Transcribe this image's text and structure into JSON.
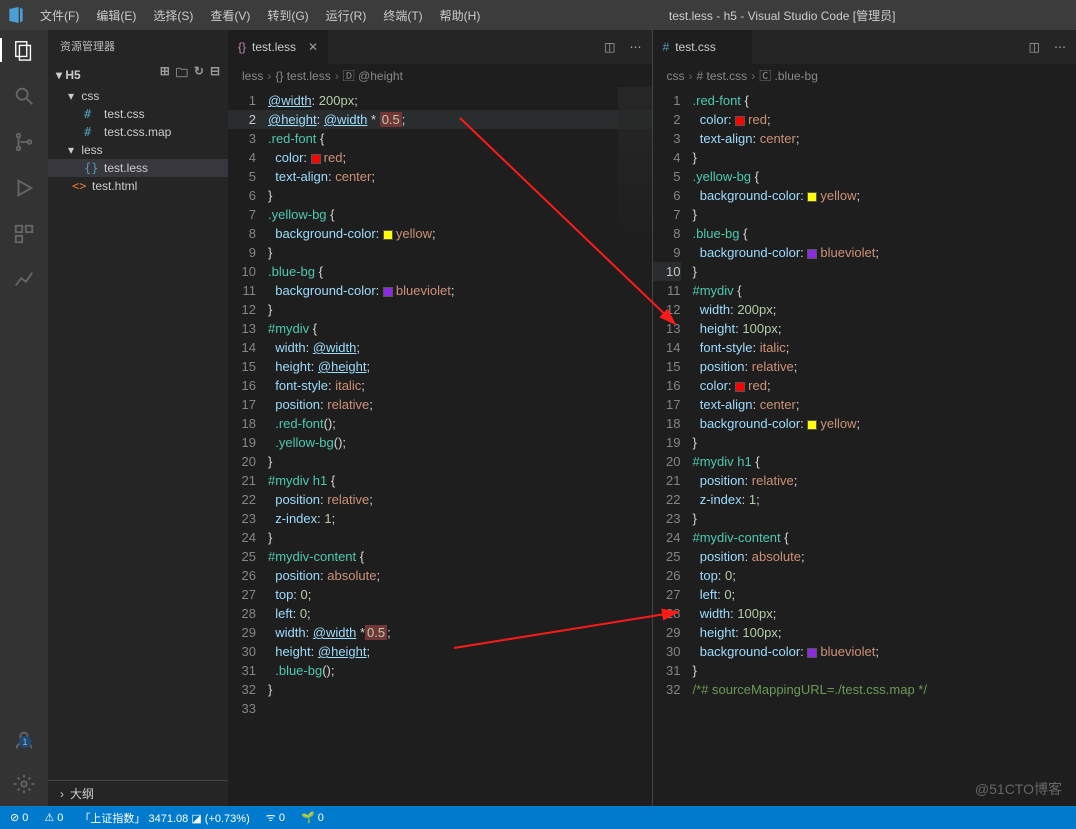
{
  "title": "test.less - h5 - Visual Studio Code [管理员]",
  "menus": [
    "文件(F)",
    "编辑(E)",
    "选择(S)",
    "查看(V)",
    "转到(G)",
    "运行(R)",
    "终端(T)",
    "帮助(H)"
  ],
  "sidebar": {
    "title": "资源管理器",
    "root": "H5",
    "folders": [
      {
        "name": "css",
        "expanded": true,
        "files": [
          {
            "name": "test.css",
            "icon": "#"
          },
          {
            "name": "test.css.map",
            "icon": "#"
          }
        ]
      },
      {
        "name": "less",
        "expanded": true,
        "files": [
          {
            "name": "test.less",
            "icon": "{}",
            "selected": true
          }
        ]
      }
    ],
    "rootFile": {
      "name": "test.html",
      "icon": "<>"
    },
    "outline": "大纲"
  },
  "left": {
    "tabLabel": "test.less",
    "breadcrumb": [
      "less",
      "test.less",
      "@height"
    ],
    "lines": 33,
    "code": [
      [
        {
          "t": "@width",
          "c": "var"
        },
        {
          "t": ": ",
          "c": "d4"
        },
        {
          "t": "200px",
          "c": "cnum"
        },
        {
          "t": ";",
          "c": "d4"
        }
      ],
      [
        {
          "t": "@height",
          "c": "var"
        },
        {
          "t": ": ",
          "c": "d4"
        },
        {
          "t": "@width",
          "c": "var"
        },
        {
          "t": " * ",
          "c": "d4"
        },
        {
          "t": "0.5",
          "c": "cnum",
          "hl": true
        },
        {
          "t": ";",
          "c": "d4"
        }
      ],
      [],
      [
        {
          "t": ".red-font ",
          "c": "sel"
        },
        {
          "t": "{",
          "c": "d4"
        }
      ],
      [
        {
          "t": "  color",
          "c": "prop"
        },
        {
          "t": ": ",
          "c": "d4"
        },
        {
          "sw": "#ff0000"
        },
        {
          "t": "red",
          "c": "crt"
        },
        {
          "t": ";",
          "c": "d4"
        }
      ],
      [
        {
          "t": "  text-align",
          "c": "prop"
        },
        {
          "t": ": ",
          "c": "d4"
        },
        {
          "t": "center",
          "c": "crt"
        },
        {
          "t": ";",
          "c": "d4"
        }
      ],
      [
        {
          "t": "}",
          "c": "d4"
        }
      ],
      [
        {
          "t": ".yellow-bg ",
          "c": "sel"
        },
        {
          "t": "{",
          "c": "d4"
        }
      ],
      [
        {
          "t": "  background-color",
          "c": "prop"
        },
        {
          "t": ": ",
          "c": "d4"
        },
        {
          "sw": "#ffff00"
        },
        {
          "t": "yellow",
          "c": "crt"
        },
        {
          "t": ";",
          "c": "d4"
        }
      ],
      [
        {
          "t": "}",
          "c": "d4"
        }
      ],
      [
        {
          "t": ".blue-bg ",
          "c": "sel"
        },
        {
          "t": "{",
          "c": "d4"
        }
      ],
      [
        {
          "t": "  background-color",
          "c": "prop"
        },
        {
          "t": ": ",
          "c": "d4"
        },
        {
          "sw": "#8a2be2"
        },
        {
          "t": "blueviolet",
          "c": "crt"
        },
        {
          "t": ";",
          "c": "d4"
        }
      ],
      [
        {
          "t": "}",
          "c": "d4"
        }
      ],
      [
        {
          "t": "#mydiv ",
          "c": "sel"
        },
        {
          "t": "{",
          "c": "d4"
        }
      ],
      [
        {
          "t": "  width",
          "c": "prop"
        },
        {
          "t": ": ",
          "c": "d4"
        },
        {
          "t": "@width",
          "c": "var"
        },
        {
          "t": ";",
          "c": "d4"
        }
      ],
      [
        {
          "t": "  height",
          "c": "prop"
        },
        {
          "t": ": ",
          "c": "d4"
        },
        {
          "t": "@height",
          "c": "var"
        },
        {
          "t": ";",
          "c": "d4"
        }
      ],
      [
        {
          "t": "  font-style",
          "c": "prop"
        },
        {
          "t": ": ",
          "c": "d4"
        },
        {
          "t": "italic",
          "c": "crt"
        },
        {
          "t": ";",
          "c": "d4"
        }
      ],
      [
        {
          "t": "  position",
          "c": "prop"
        },
        {
          "t": ": ",
          "c": "d4"
        },
        {
          "t": "relative",
          "c": "crt"
        },
        {
          "t": ";",
          "c": "d4"
        }
      ],
      [
        {
          "t": "  .red-font",
          "c": "sel"
        },
        {
          "t": "();",
          "c": "d4"
        }
      ],
      [
        {
          "t": "  .yellow-bg",
          "c": "sel"
        },
        {
          "t": "();",
          "c": "d4"
        }
      ],
      [
        {
          "t": "}",
          "c": "d4"
        }
      ],
      [
        {
          "t": "#mydiv h1 ",
          "c": "sel"
        },
        {
          "t": "{",
          "c": "d4"
        }
      ],
      [
        {
          "t": "  position",
          "c": "prop"
        },
        {
          "t": ": ",
          "c": "d4"
        },
        {
          "t": "relative",
          "c": "crt"
        },
        {
          "t": ";",
          "c": "d4"
        }
      ],
      [
        {
          "t": "  z-index",
          "c": "prop"
        },
        {
          "t": ": ",
          "c": "d4"
        },
        {
          "t": "1",
          "c": "cnum"
        },
        {
          "t": ";",
          "c": "d4"
        }
      ],
      [
        {
          "t": "}",
          "c": "d4"
        }
      ],
      [
        {
          "t": "#mydiv-content ",
          "c": "sel"
        },
        {
          "t": "{",
          "c": "d4"
        }
      ],
      [
        {
          "t": "  position",
          "c": "prop"
        },
        {
          "t": ": ",
          "c": "d4"
        },
        {
          "t": "absolute",
          "c": "crt"
        },
        {
          "t": ";",
          "c": "d4"
        }
      ],
      [
        {
          "t": "  top",
          "c": "prop"
        },
        {
          "t": ": ",
          "c": "d4"
        },
        {
          "t": "0",
          "c": "cnum"
        },
        {
          "t": ";",
          "c": "d4"
        }
      ],
      [
        {
          "t": "  left",
          "c": "prop"
        },
        {
          "t": ": ",
          "c": "d4"
        },
        {
          "t": "0",
          "c": "cnum"
        },
        {
          "t": ";",
          "c": "d4"
        }
      ],
      [
        {
          "t": "  width",
          "c": "prop"
        },
        {
          "t": ": ",
          "c": "d4"
        },
        {
          "t": "@width",
          "c": "var"
        },
        {
          "t": " *",
          "c": "d4"
        },
        {
          "t": "0.5",
          "c": "cnum",
          "hl": true
        },
        {
          "t": ";",
          "c": "d4"
        }
      ],
      [
        {
          "t": "  height",
          "c": "prop"
        },
        {
          "t": ": ",
          "c": "d4"
        },
        {
          "t": "@height",
          "c": "var"
        },
        {
          "t": ";",
          "c": "d4"
        }
      ],
      [
        {
          "t": "  .blue-bg",
          "c": "sel"
        },
        {
          "t": "();",
          "c": "d4"
        }
      ],
      [
        {
          "t": "}",
          "c": "d4"
        }
      ]
    ]
  },
  "right": {
    "tabLabel": "test.css",
    "breadcrumb": [
      "css",
      "test.css",
      ".blue-bg"
    ],
    "lines": 32,
    "code": [
      [
        {
          "t": ".red-font ",
          "c": "sel"
        },
        {
          "t": "{",
          "c": "d4"
        }
      ],
      [
        {
          "t": "  color",
          "c": "prop"
        },
        {
          "t": ": ",
          "c": "d4"
        },
        {
          "sw": "#ff0000"
        },
        {
          "t": "red",
          "c": "crt"
        },
        {
          "t": ";",
          "c": "d4"
        }
      ],
      [
        {
          "t": "  text-align",
          "c": "prop"
        },
        {
          "t": ": ",
          "c": "d4"
        },
        {
          "t": "center",
          "c": "crt"
        },
        {
          "t": ";",
          "c": "d4"
        }
      ],
      [
        {
          "t": "}",
          "c": "d4"
        }
      ],
      [
        {
          "t": ".yellow-bg ",
          "c": "sel"
        },
        {
          "t": "{",
          "c": "d4"
        }
      ],
      [
        {
          "t": "  background-color",
          "c": "prop"
        },
        {
          "t": ": ",
          "c": "d4"
        },
        {
          "sw": "#ffff00"
        },
        {
          "t": "yellow",
          "c": "crt"
        },
        {
          "t": ";",
          "c": "d4"
        }
      ],
      [
        {
          "t": "}",
          "c": "d4"
        }
      ],
      [
        {
          "t": ".blue-bg ",
          "c": "sel"
        },
        {
          "t": "{",
          "c": "d4"
        }
      ],
      [
        {
          "t": "  background-color",
          "c": "prop"
        },
        {
          "t": ": ",
          "c": "d4"
        },
        {
          "sw": "#8a2be2"
        },
        {
          "t": "blueviolet",
          "c": "crt"
        },
        {
          "t": ";",
          "c": "d4"
        }
      ],
      [
        {
          "t": "}",
          "c": "d4"
        }
      ],
      [
        {
          "t": "#mydiv ",
          "c": "sel"
        },
        {
          "t": "{",
          "c": "d4"
        }
      ],
      [
        {
          "t": "  width",
          "c": "prop"
        },
        {
          "t": ": ",
          "c": "d4"
        },
        {
          "t": "200px",
          "c": "cnum"
        },
        {
          "t": ";",
          "c": "d4"
        }
      ],
      [
        {
          "t": "  height",
          "c": "prop"
        },
        {
          "t": ": ",
          "c": "d4"
        },
        {
          "t": "100px",
          "c": "cnum"
        },
        {
          "t": ";",
          "c": "d4"
        }
      ],
      [
        {
          "t": "  font-style",
          "c": "prop"
        },
        {
          "t": ": ",
          "c": "d4"
        },
        {
          "t": "italic",
          "c": "crt"
        },
        {
          "t": ";",
          "c": "d4"
        }
      ],
      [
        {
          "t": "  position",
          "c": "prop"
        },
        {
          "t": ": ",
          "c": "d4"
        },
        {
          "t": "relative",
          "c": "crt"
        },
        {
          "t": ";",
          "c": "d4"
        }
      ],
      [
        {
          "t": "  color",
          "c": "prop"
        },
        {
          "t": ": ",
          "c": "d4"
        },
        {
          "sw": "#ff0000"
        },
        {
          "t": "red",
          "c": "crt"
        },
        {
          "t": ";",
          "c": "d4"
        }
      ],
      [
        {
          "t": "  text-align",
          "c": "prop"
        },
        {
          "t": ": ",
          "c": "d4"
        },
        {
          "t": "center",
          "c": "crt"
        },
        {
          "t": ";",
          "c": "d4"
        }
      ],
      [
        {
          "t": "  background-color",
          "c": "prop"
        },
        {
          "t": ": ",
          "c": "d4"
        },
        {
          "sw": "#ffff00"
        },
        {
          "t": "yellow",
          "c": "crt"
        },
        {
          "t": ";",
          "c": "d4"
        }
      ],
      [
        {
          "t": "}",
          "c": "d4"
        }
      ],
      [
        {
          "t": "#mydiv h1 ",
          "c": "sel"
        },
        {
          "t": "{",
          "c": "d4"
        }
      ],
      [
        {
          "t": "  position",
          "c": "prop"
        },
        {
          "t": ": ",
          "c": "d4"
        },
        {
          "t": "relative",
          "c": "crt"
        },
        {
          "t": ";",
          "c": "d4"
        }
      ],
      [
        {
          "t": "  z-index",
          "c": "prop"
        },
        {
          "t": ": ",
          "c": "d4"
        },
        {
          "t": "1",
          "c": "cnum"
        },
        {
          "t": ";",
          "c": "d4"
        }
      ],
      [
        {
          "t": "}",
          "c": "d4"
        }
      ],
      [
        {
          "t": "#mydiv-content ",
          "c": "sel"
        },
        {
          "t": "{",
          "c": "d4"
        }
      ],
      [
        {
          "t": "  position",
          "c": "prop"
        },
        {
          "t": ": ",
          "c": "d4"
        },
        {
          "t": "absolute",
          "c": "crt"
        },
        {
          "t": ";",
          "c": "d4"
        }
      ],
      [
        {
          "t": "  top",
          "c": "prop"
        },
        {
          "t": ": ",
          "c": "d4"
        },
        {
          "t": "0",
          "c": "cnum"
        },
        {
          "t": ";",
          "c": "d4"
        }
      ],
      [
        {
          "t": "  left",
          "c": "prop"
        },
        {
          "t": ": ",
          "c": "d4"
        },
        {
          "t": "0",
          "c": "cnum"
        },
        {
          "t": ";",
          "c": "d4"
        }
      ],
      [
        {
          "t": "  width",
          "c": "prop"
        },
        {
          "t": ": ",
          "c": "d4"
        },
        {
          "t": "100px",
          "c": "cnum"
        },
        {
          "t": ";",
          "c": "d4"
        }
      ],
      [
        {
          "t": "  height",
          "c": "prop"
        },
        {
          "t": ": ",
          "c": "d4"
        },
        {
          "t": "100px",
          "c": "cnum"
        },
        {
          "t": ";",
          "c": "d4"
        }
      ],
      [
        {
          "t": "  background-color",
          "c": "prop"
        },
        {
          "t": ": ",
          "c": "d4"
        },
        {
          "sw": "#8a2be2"
        },
        {
          "t": "blueviolet",
          "c": "crt"
        },
        {
          "t": ";",
          "c": "d4"
        }
      ],
      [
        {
          "t": "}",
          "c": "d4"
        }
      ],
      [
        {
          "t": "/*# sourceMappingURL=./test.css.map */",
          "c": "comment"
        }
      ]
    ]
  },
  "status": {
    "errors": "⊘ 0",
    "warnings": "⚠ 0",
    "stock": "「上证指数」 3471.08",
    "stockIcon": "◪",
    "stockChange": "(+0.73%)",
    "port": "ᯤ 0",
    "bean": "🌱 0"
  },
  "watermark": "@51CTO博客"
}
